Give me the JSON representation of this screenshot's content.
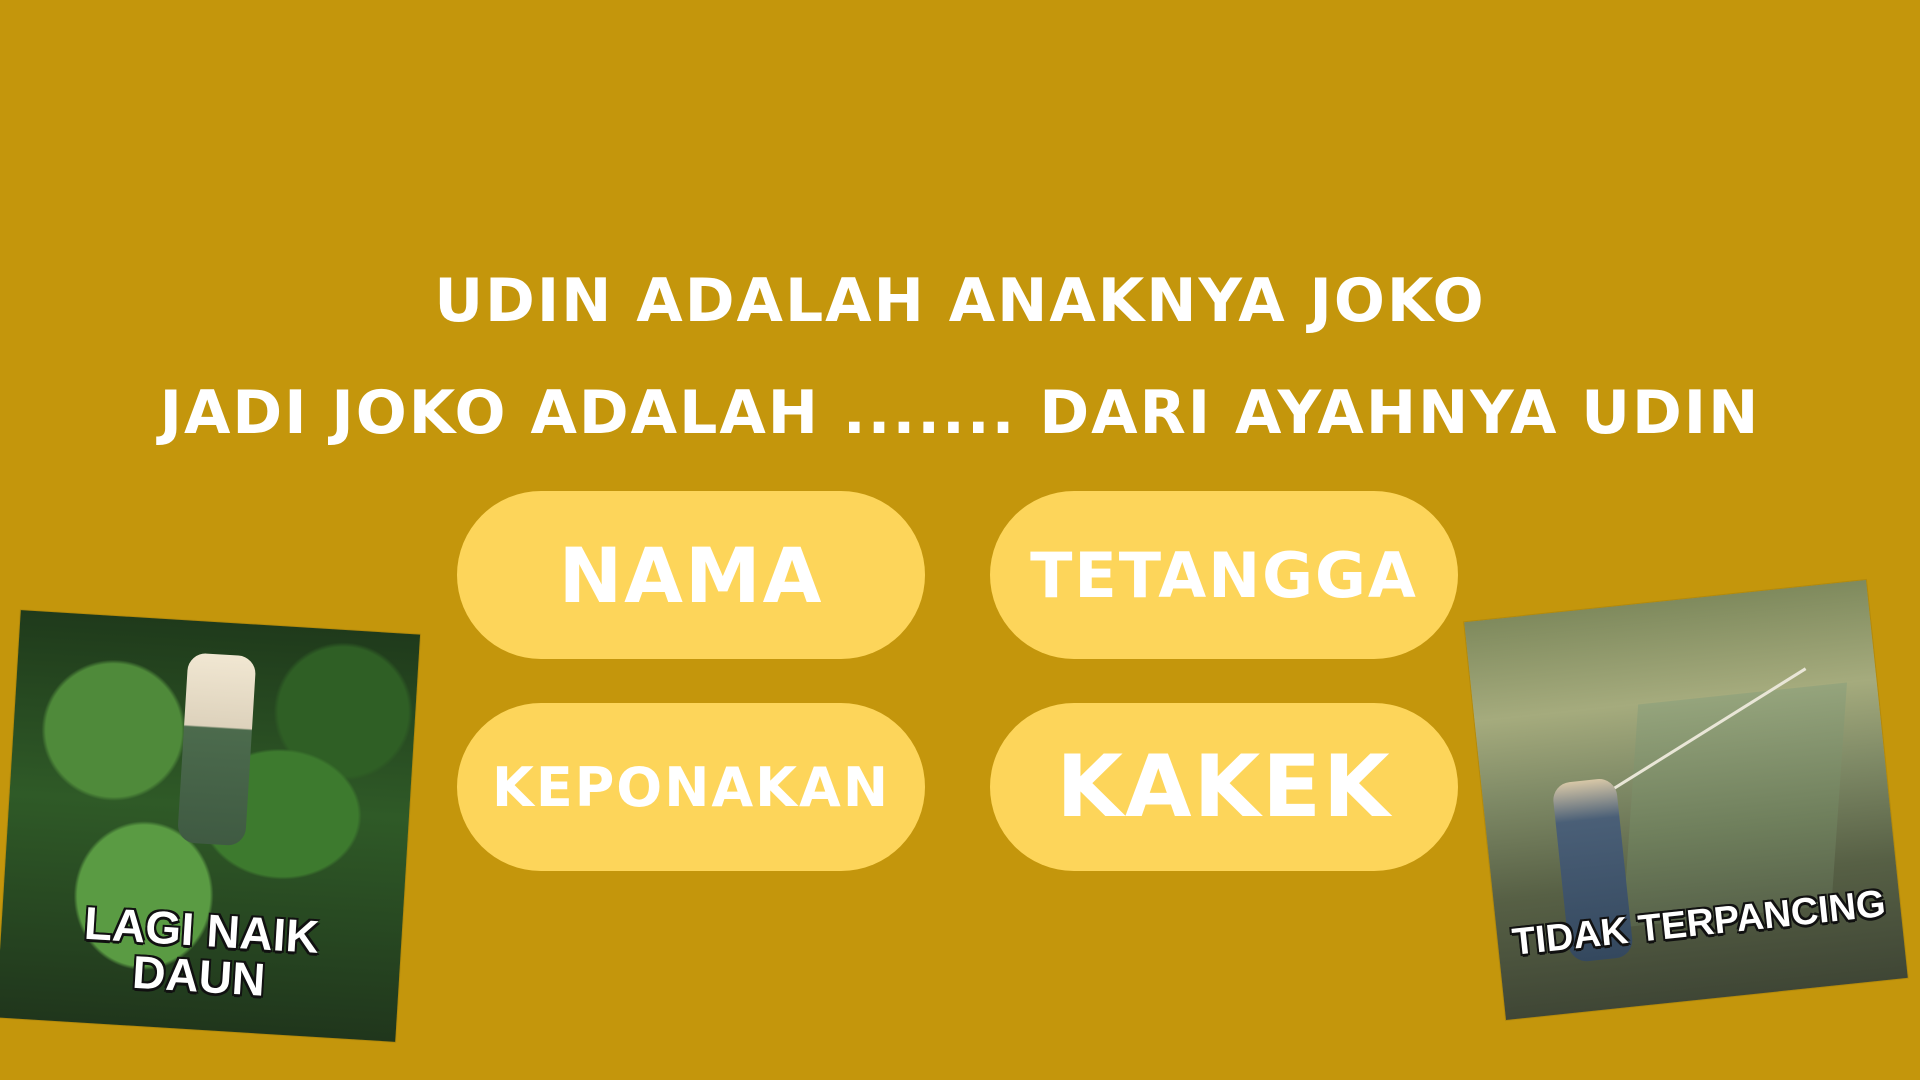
{
  "question": {
    "line1": "UDIN ADALAH ANAKNYA JOKO",
    "line2": "JADI JOKO ADALAH ....... DARI AYAHNYA UDIN"
  },
  "answers": {
    "a": "NAMA",
    "b": "TETANGGA",
    "c": "KEPONAKAN",
    "d": "KAKEK"
  },
  "memes": {
    "left_caption": "LAGI NAIK DAUN",
    "right_caption": "TIDAK TERPANCING"
  },
  "colors": {
    "background": "#C4960C",
    "button_fill": "#FDD55A",
    "text": "#FFFFFF"
  }
}
